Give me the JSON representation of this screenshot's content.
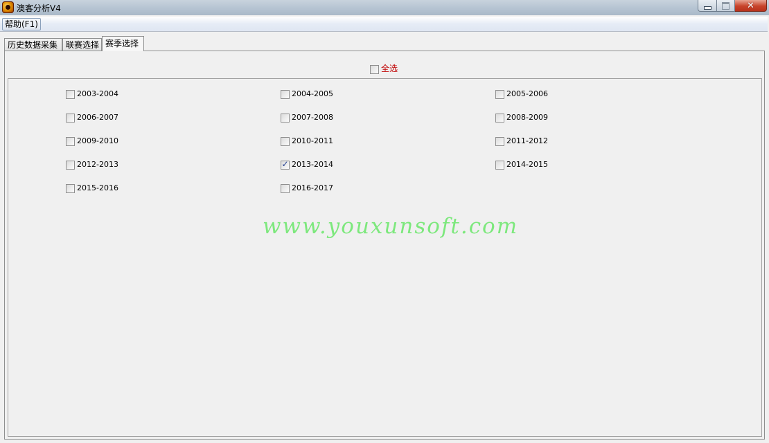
{
  "window": {
    "title": "澳客分析V4"
  },
  "menu": {
    "help": "帮助(F1)"
  },
  "tabs": [
    {
      "label": "历史数据采集",
      "active": false
    },
    {
      "label": "联赛选择",
      "active": false
    },
    {
      "label": "赛季选择",
      "active": true
    }
  ],
  "select_all": {
    "label": "全选",
    "checked": false,
    "label_color": "#c00000"
  },
  "seasons": [
    {
      "label": "2003-2004",
      "checked": false
    },
    {
      "label": "2004-2005",
      "checked": false
    },
    {
      "label": "2005-2006",
      "checked": false
    },
    {
      "label": "2006-2007",
      "checked": false
    },
    {
      "label": "2007-2008",
      "checked": false
    },
    {
      "label": "2008-2009",
      "checked": false
    },
    {
      "label": "2009-2010",
      "checked": false
    },
    {
      "label": "2010-2011",
      "checked": false
    },
    {
      "label": "2011-2012",
      "checked": false
    },
    {
      "label": "2012-2013",
      "checked": false
    },
    {
      "label": "2013-2014",
      "checked": true
    },
    {
      "label": "2014-2015",
      "checked": false
    },
    {
      "label": "2015-2016",
      "checked": false
    },
    {
      "label": "2016-2017",
      "checked": false
    }
  ],
  "watermark": {
    "text": "www.youxunsoft.com",
    "color": "#7de87d"
  },
  "icons": {
    "app": "app-logo-icon",
    "minimize": "minimize-icon",
    "maximize": "maximize-icon",
    "close": "close-icon",
    "check": "checkmark-icon"
  }
}
